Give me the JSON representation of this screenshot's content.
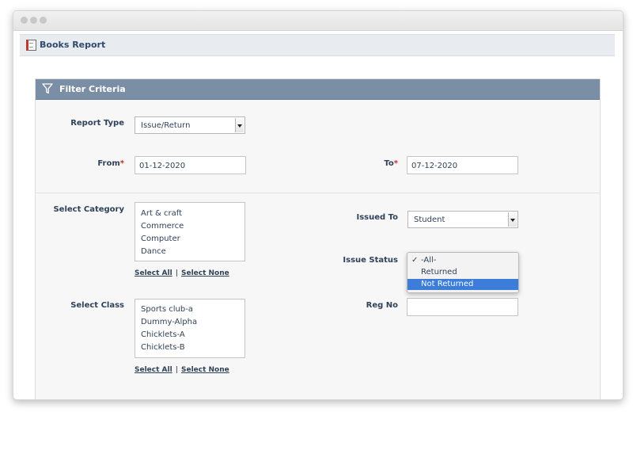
{
  "report": {
    "title": "Books Report",
    "icon": "report-book-icon"
  },
  "filter": {
    "title": "Filter Criteria",
    "icon": "funnel-icon"
  },
  "report_type": {
    "label": "Report Type",
    "value": "Issue/Return"
  },
  "from": {
    "label": "From",
    "required_mark": "*",
    "value": "01-12-2020"
  },
  "to": {
    "label": "To",
    "required_mark": "*",
    "value": "07-12-2020"
  },
  "category": {
    "label": "Select Category",
    "options": [
      "Art & craft",
      "Commerce",
      "Computer",
      "Dance"
    ],
    "select_all": "Select All",
    "separator": "|",
    "select_none": "Select None"
  },
  "issued_to": {
    "label": "Issued To",
    "value": "Student"
  },
  "issue_status": {
    "label": "Issue Status",
    "options": [
      "-All-",
      "Returned",
      "Not Returned"
    ],
    "checked": "✓",
    "highlighted": "Not Returned"
  },
  "class": {
    "label": "Select Class",
    "options": [
      "Sports club-a",
      "Dummy-Alpha",
      "Chicklets-A",
      "Chicklets-B"
    ],
    "select_all": "Select All",
    "separator": "|",
    "select_none": "Select None"
  },
  "reg_no": {
    "label": "Reg No",
    "value": ""
  },
  "colors": {
    "header": "#7a8ea6",
    "label": "#2f4258",
    "highlight": "#3b7dd8",
    "required": "#cc2b2b"
  }
}
